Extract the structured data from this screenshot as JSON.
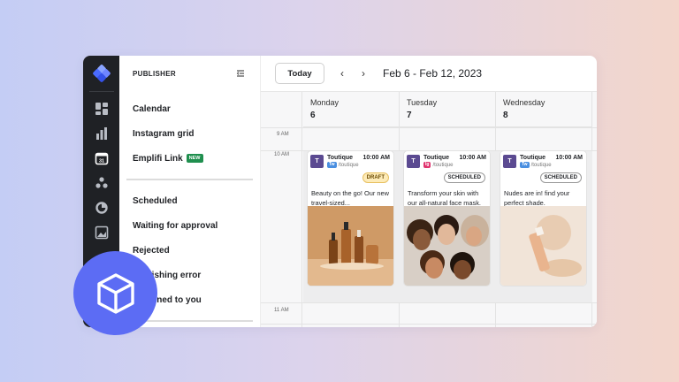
{
  "sidebar": {
    "title": "PUBLISHER",
    "items_top": [
      {
        "label": "Calendar"
      },
      {
        "label": "Instagram grid"
      },
      {
        "label": "Emplifi Link",
        "badge": "NEW"
      }
    ],
    "items_bottom": [
      {
        "label": "Scheduled"
      },
      {
        "label": "Waiting for approval"
      },
      {
        "label": "Rejected"
      },
      {
        "label": "Publishing error"
      },
      {
        "label": "Assigned to you"
      }
    ]
  },
  "toolbar": {
    "today_label": "Today",
    "date_range": "Feb 6 - Feb 12, 2023"
  },
  "calendar": {
    "days": [
      {
        "name": "Monday",
        "num": "6"
      },
      {
        "name": "Tuesday",
        "num": "7"
      },
      {
        "name": "Wednesday",
        "num": "8"
      }
    ],
    "times": [
      "9 AM",
      "10 AM",
      "11 AM"
    ],
    "posts": [
      {
        "account": "Toutique",
        "time": "10:00 AM",
        "network": "Tw",
        "network_color": "#4a8fe0",
        "handle": "/toutique",
        "status": "DRAFT",
        "text": "Beauty on the go! Our new travel-sized..."
      },
      {
        "account": "Toutique",
        "time": "10:00 AM",
        "network": "Ig",
        "network_color": "#e0336e",
        "handle": "/toutique",
        "status": "SCHEDULED",
        "text": "Transform your skin with our all-natural face mask."
      },
      {
        "account": "Toutique",
        "time": "10:00 AM",
        "network": "Tw",
        "network_color": "#4a8fe0",
        "handle": "/toutique",
        "status": "SCHEDULED",
        "text": "Nudes are in! find your perfect shade."
      }
    ]
  },
  "colors": {
    "rail": "#1f2125",
    "accent": "#5c6cf4",
    "new_badge": "#1f8f4e"
  }
}
